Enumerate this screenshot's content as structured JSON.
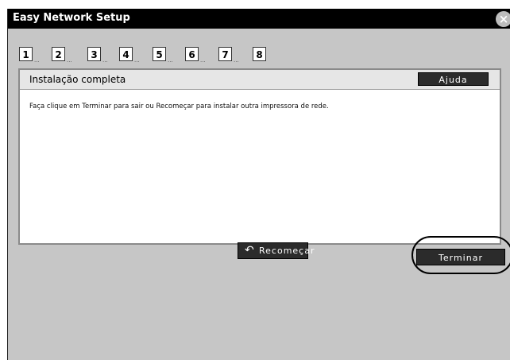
{
  "window": {
    "title": "Easy Network Setup"
  },
  "steps": [
    {
      "label": "1",
      "dots": "..."
    },
    {
      "label": "2",
      "dots": "..."
    },
    {
      "label": "3",
      "dots": "..."
    },
    {
      "label": "4",
      "dots": "..."
    },
    {
      "label": "5",
      "dots": "..."
    },
    {
      "label": "6",
      "dots": "..."
    },
    {
      "label": "7",
      "dots": "..."
    },
    {
      "label": "8",
      "dots": ""
    }
  ],
  "panel": {
    "title": "Instalação completa",
    "help_label": "Ajuda",
    "message": "Faça clique em Terminar para sair ou Recomeçar para instalar outra impressora de rede."
  },
  "buttons": {
    "restart_label": "Recomeçar",
    "finish_label": "Terminar"
  }
}
